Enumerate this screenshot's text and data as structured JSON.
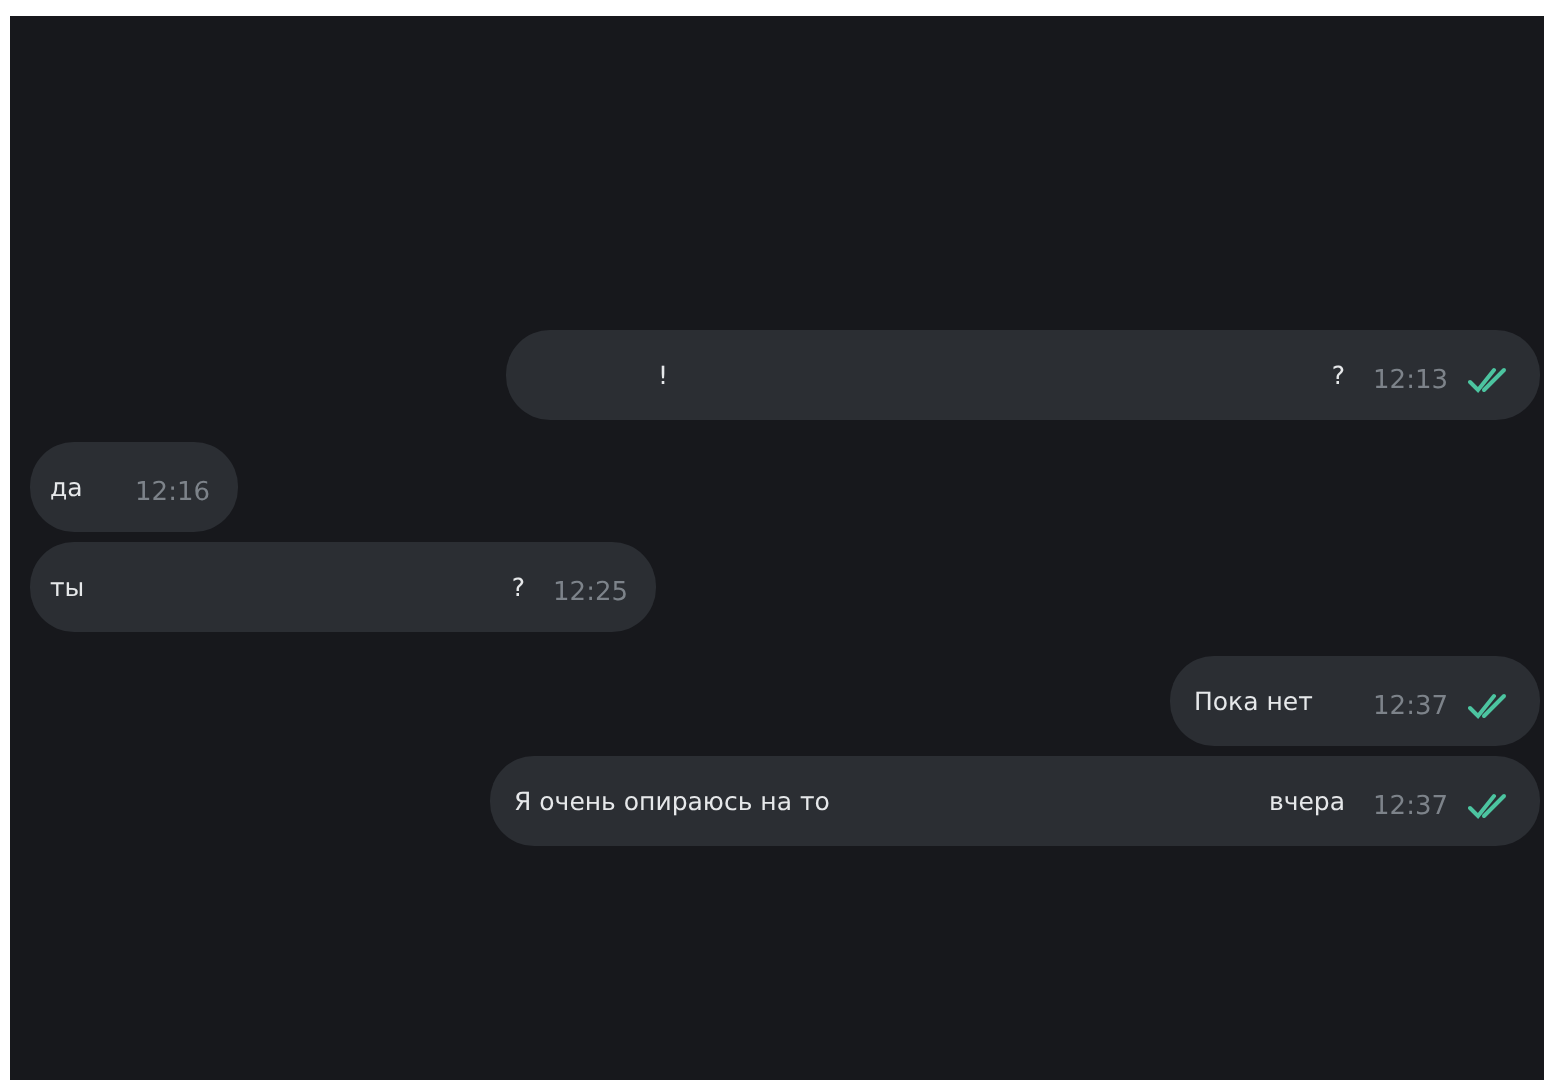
{
  "messages": [
    {
      "kind": "sent",
      "segments": [
        "!",
        "?"
      ],
      "time": "12:13",
      "read": true
    },
    {
      "kind": "received",
      "segments": [
        "да"
      ],
      "time": "12:16"
    },
    {
      "kind": "received",
      "segments": [
        "ты",
        "?"
      ],
      "time": "12:25"
    },
    {
      "kind": "sent",
      "segments": [
        "Пока нет"
      ],
      "time": "12:37",
      "read": true
    },
    {
      "kind": "sent",
      "segments": [
        "Я очень опираюсь на то",
        "вчера"
      ],
      "time": "12:37",
      "read": true
    }
  ]
}
